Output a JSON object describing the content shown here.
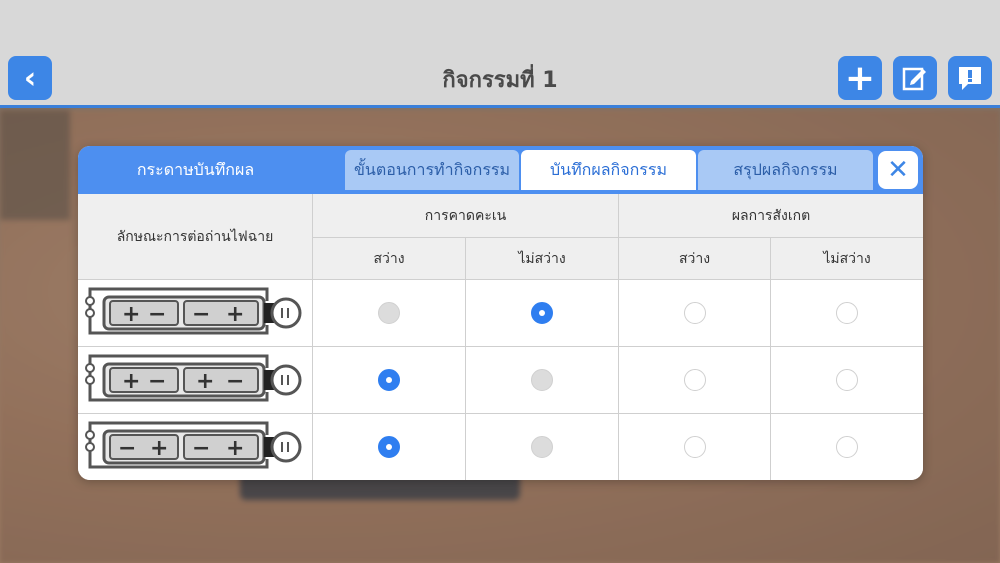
{
  "header": {
    "title": "กิจกรรมที่ 1",
    "back_icon": "chevron-left-icon",
    "add_icon": "plus-icon",
    "edit_icon": "edit-icon",
    "info_icon": "info-icon",
    "accent": "#3d86e6"
  },
  "modal": {
    "title": "กระดาษบันทึกผล",
    "tabs": [
      {
        "label": "ขั้นตอนการทำกิจกรรม",
        "active": false
      },
      {
        "label": "บันทึกผลกิจกรรม",
        "active": true
      },
      {
        "label": "สรุปผลกิจกรรม",
        "active": false
      }
    ],
    "close_icon": "close-icon",
    "table": {
      "row_header": "ลักษณะการต่อถ่านไฟฉาย",
      "group_predict": "การคาดคะเน",
      "group_observe": "ผลการสังเกต",
      "col_bright": "สว่าง",
      "col_not_bright": "ไม่สว่าง",
      "rows": [
        {
          "circuit": "battery-circuit-plus-minus-minus-plus",
          "predict": "ไม่สว่าง",
          "observe": ""
        },
        {
          "circuit": "battery-circuit-plus-minus-plus-minus",
          "predict": "สว่าง",
          "observe": ""
        },
        {
          "circuit": "battery-circuit-minus-plus-minus-plus",
          "predict": "สว่าง",
          "observe": ""
        }
      ]
    }
  }
}
